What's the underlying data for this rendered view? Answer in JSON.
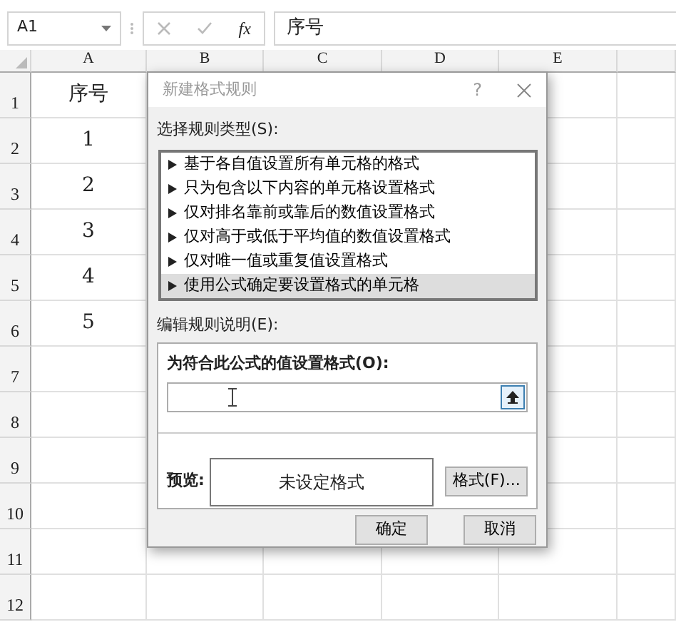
{
  "name_box": {
    "value": "A1"
  },
  "formula_bar": {
    "function_label": "fx",
    "value": "序号"
  },
  "sheet": {
    "columns": [
      "A",
      "B",
      "C",
      "D",
      "E"
    ],
    "rows": [
      "1",
      "2",
      "3",
      "4",
      "5",
      "6",
      "7",
      "8",
      "9",
      "10",
      "11",
      "12"
    ],
    "column_a": [
      "序号",
      "1",
      "2",
      "3",
      "4",
      "5"
    ]
  },
  "dialog": {
    "title": "新建格式规则",
    "help": "?",
    "rule_type_label": "选择规则类型(S):",
    "rule_types": [
      {
        "label": "基于各自值设置所有单元格的格式",
        "selected": false
      },
      {
        "label": "只为包含以下内容的单元格设置格式",
        "selected": false
      },
      {
        "label": "仅对排名靠前或靠后的数值设置格式",
        "selected": false
      },
      {
        "label": "仅对高于或低于平均值的数值设置格式",
        "selected": false
      },
      {
        "label": "仅对唯一值或重复值设置格式",
        "selected": false
      },
      {
        "label": "使用公式确定要设置格式的单元格",
        "selected": true
      }
    ],
    "edit_label": "编辑规则说明(E):",
    "formula_label": "为符合此公式的值设置格式(O):",
    "preview_label": "预览:",
    "preview_text": "未设定格式",
    "format_button": "格式(F)...",
    "buttons": [
      "确定",
      "取消"
    ]
  }
}
